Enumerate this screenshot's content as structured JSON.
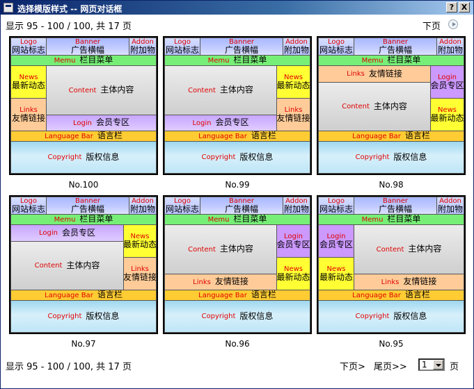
{
  "window": {
    "title": "选择模版样式 -- 网页对话框",
    "help_label": "?",
    "close_label": "X"
  },
  "pager": {
    "summary": "显示 95 - 100 / 100, 共 17 页",
    "prev_label": "下页",
    "next_label": "下页>",
    "last_label": "尾页>>",
    "page_select_value": "1",
    "page_word": "页"
  },
  "blocks": {
    "logo_en": "Logo",
    "logo_cn": "网站标志",
    "banner_en": "Banner",
    "banner_cn": "广告横幅",
    "addon_en": "Addon",
    "addon_cn": "附加物",
    "menu_en": "Memu",
    "menu_cn": "栏目菜单",
    "news_en": "News",
    "news_cn": "最新动态",
    "links_en": "Links",
    "links_cn": "友情链接",
    "content_en": "Content",
    "content_cn": "主体内容",
    "login_en": "Login",
    "login_cn": "会员专区",
    "lang_en": "Language Bar",
    "lang_cn": "语言栏",
    "copy_en": "Copyright",
    "copy_cn": "版权信息"
  },
  "templates": [
    {
      "label": "No.100"
    },
    {
      "label": "No.99"
    },
    {
      "label": "No.98"
    },
    {
      "label": "No.97"
    },
    {
      "label": "No.96"
    },
    {
      "label": "No.95"
    }
  ]
}
